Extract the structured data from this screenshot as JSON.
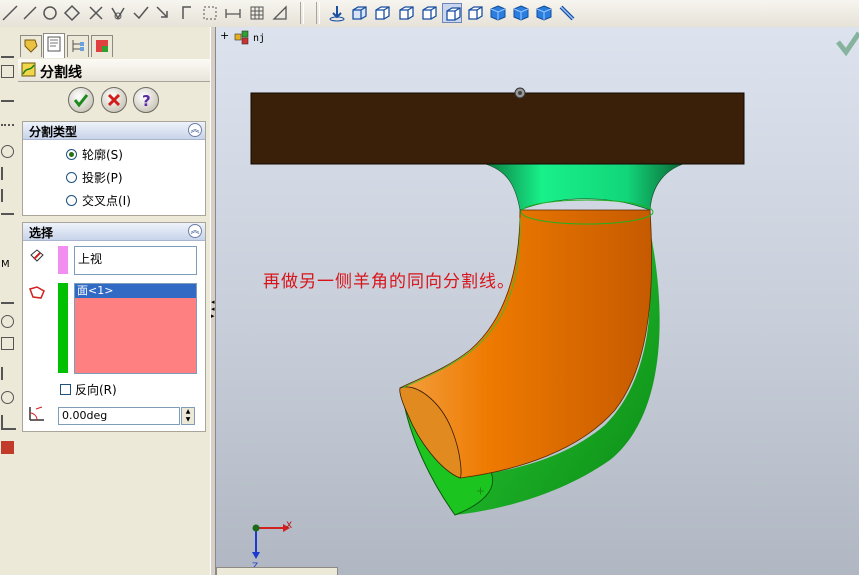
{
  "toolbar": {
    "left_icons": [
      "line-icon",
      "circle-icon",
      "cross-icon",
      "trim-icon",
      "check-icon",
      "bracket-icon",
      "dashed-rect-icon",
      "dimension-icon",
      "grid-icon",
      "angle-icon"
    ],
    "view_icons": [
      "rotate-view-icon",
      "view-cube-1-icon",
      "view-cube-2-icon",
      "view-cube-3-icon",
      "view-cube-4-icon",
      "view-cube-5-icon",
      "view-cube-6-icon",
      "shaded-cube-1-icon",
      "shaded-cube-2-icon",
      "shaded-cube-3-icon",
      "section-view-icon"
    ]
  },
  "property_manager": {
    "tabs": [
      "feature-manager-icon",
      "property-manager-icon",
      "configuration-manager-icon",
      "display-manager-icon"
    ],
    "title": "分割线",
    "ok_icon": "ok-icon",
    "cancel_icon": "cancel-icon",
    "help_icon": "help-icon",
    "split_type": {
      "header": "分割类型",
      "options": [
        {
          "label": "轮廓(S)",
          "selected": true
        },
        {
          "label": "投影(P)",
          "selected": false
        },
        {
          "label": "交叉点(I)",
          "selected": false
        }
      ]
    },
    "selection": {
      "header": "选择",
      "plane_value": "上视",
      "faces": [
        "面<1>"
      ],
      "reverse_label": "反向(R)",
      "angle_value": "0.00deg"
    },
    "colors": {
      "plane_swatch": "#f28ef0",
      "face_swatch": "#00c000",
      "face_list_bg": "#ff8080",
      "face_selected_bg": "#316ac5"
    }
  },
  "viewport": {
    "tree_root": "nj",
    "annotation": "再做另一侧羊角的同向分割线。",
    "axes": {
      "x": "X",
      "z": "Z"
    },
    "colors": {
      "bar": "#3a2008",
      "neck": "#11e07a",
      "elbow": "#f07800",
      "back": "#17c520"
    }
  }
}
